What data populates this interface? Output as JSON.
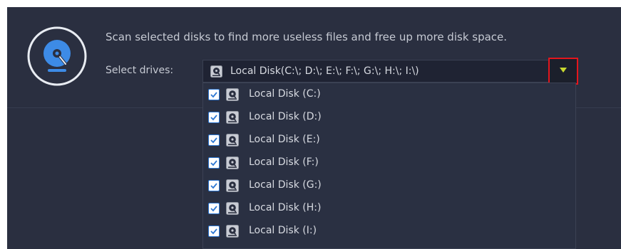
{
  "header": {
    "description": "Scan selected disks to find more useless files and free up more disk space.",
    "select_label": "Select drives:",
    "logo_icon": "disk-cleanup-icon"
  },
  "combo": {
    "value": "Local Disk(C:\\; D:\\; E:\\; F:\\; G:\\; H:\\; I:\\)",
    "icon": "hard-disk-icon"
  },
  "dropdown_button": {
    "icon": "triangle-down-icon",
    "highlight_color": "#e4161d",
    "arrow_color": "#c8d830"
  },
  "drives": [
    {
      "label": "Local Disk (C:)",
      "checked": true
    },
    {
      "label": "Local Disk (D:)",
      "checked": true
    },
    {
      "label": "Local Disk (E:)",
      "checked": true
    },
    {
      "label": "Local Disk (F:)",
      "checked": true
    },
    {
      "label": "Local Disk (G:)",
      "checked": true
    },
    {
      "label": "Local Disk (H:)",
      "checked": true
    },
    {
      "label": "Local Disk (I:)",
      "checked": true
    }
  ],
  "colors": {
    "panel": "#2a2f40",
    "accent": "#2e78d3",
    "logo_blue": "#3d8be6"
  }
}
